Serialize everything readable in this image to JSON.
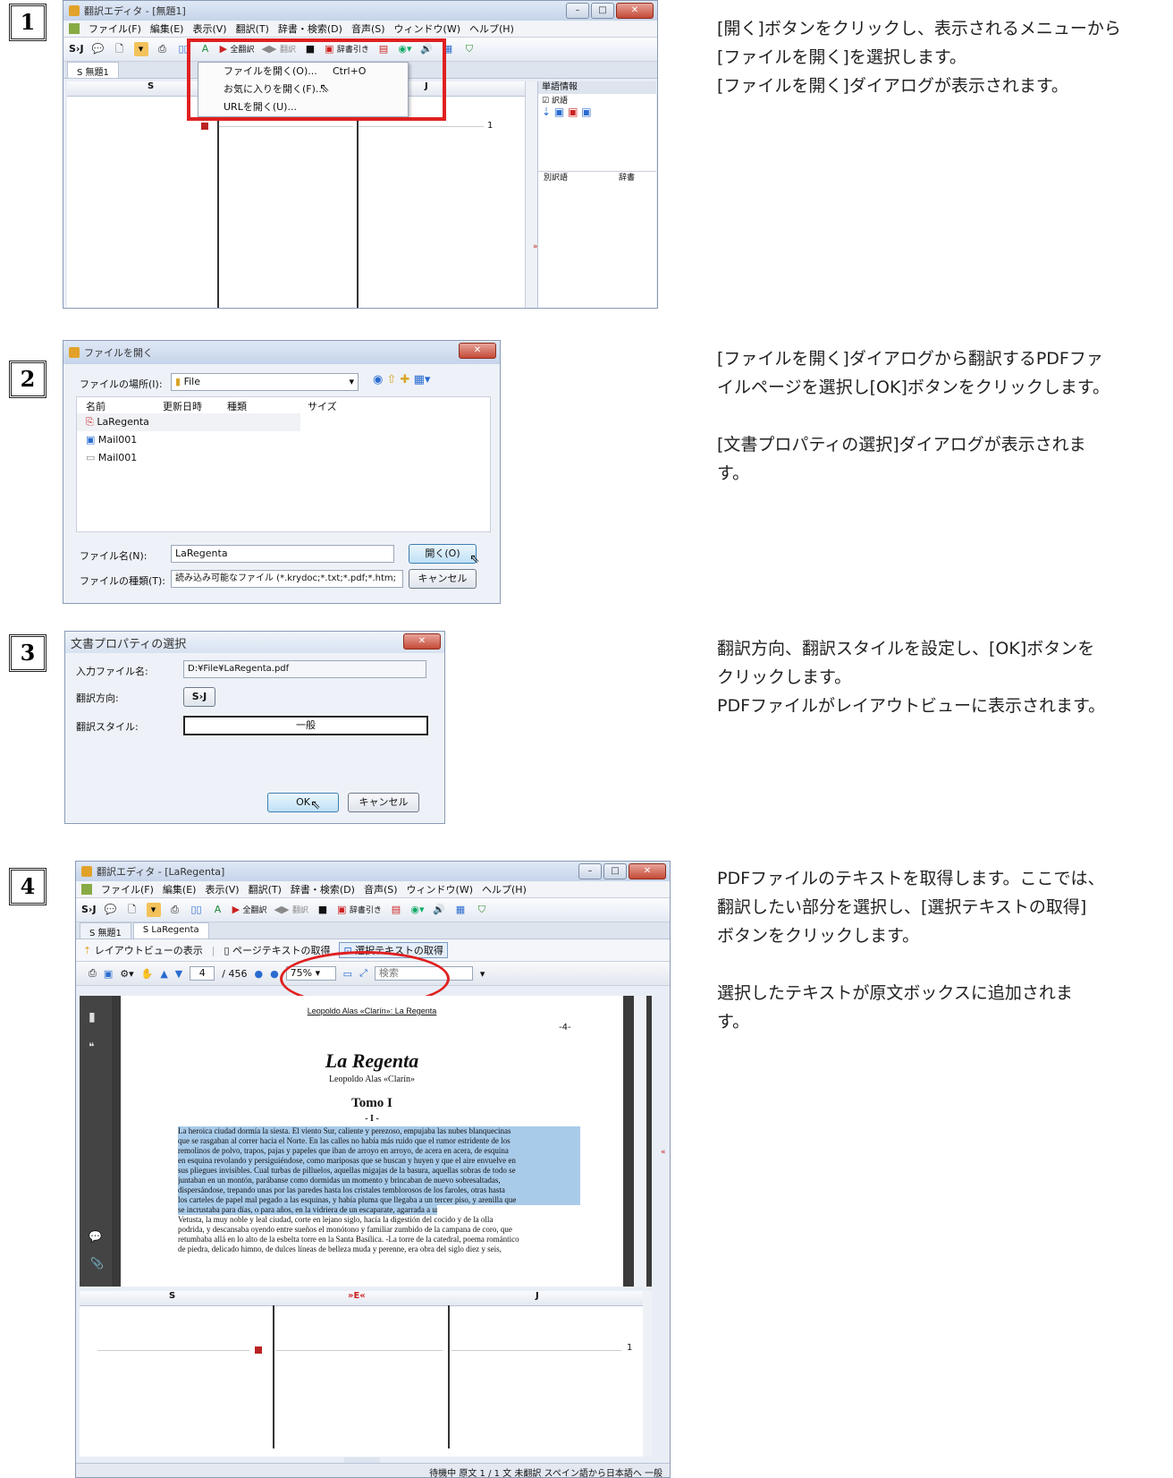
{
  "steps": [
    {
      "number": "1",
      "description": [
        "[開く]ボタンをクリックし、表示されるメニューから",
        "[ファイルを開く]を選択します。",
        "[ファイルを開く]ダイアログが表示されます。"
      ],
      "window_title": "翻訳エディタ - [無題1]",
      "menus": [
        "ファイル(F)",
        "編集(E)",
        "表示(V)",
        "翻訳(T)",
        "辞書・検索(D)",
        "音声(S)",
        "ウィンドウ(W)",
        "ヘルプ(H)"
      ],
      "toolbar": {
        "direction": "S›J",
        "all_translate": "全翻訳",
        "translate": "翻訳",
        "dict_lookup": "辞書引き"
      },
      "tab": "S 無題1",
      "columns": [
        "S",
        "J"
      ],
      "open_menu": [
        {
          "label": "ファイルを開く(O)...",
          "shortcut": "Ctrl+O"
        },
        {
          "label": "お気に入りを開く(F)...",
          "shortcut": ""
        },
        {
          "label": "URLを開く(U)...",
          "shortcut": ""
        }
      ],
      "side_panel": {
        "title": "単語情報",
        "checkbox": "訳語",
        "col_a": "別訳語",
        "col_b": "辞書"
      },
      "row_number": "1"
    },
    {
      "number": "2",
      "description": [
        "[ファイルを開く]ダイアログから翻訳するPDFファ",
        "イルページを選択し[OK]ボタンをクリックします。",
        "",
        "[文書プロパティの選択]ダイアログが表示されま",
        "す。"
      ],
      "dialog_title": "ファイルを開く",
      "location_label": "ファイルの場所(I):",
      "location_value": "File",
      "headers": [
        "名前",
        "更新日時",
        "種類",
        "サイズ"
      ],
      "files": [
        "LaRegenta",
        "Mail001",
        "Mail001"
      ],
      "filename_label": "ファイル名(N):",
      "filename_value": "LaRegenta",
      "filetype_label": "ファイルの種類(T):",
      "filetype_value": "読み込み可能なファイル (*.krydoc;*.txt;*.pdf;*.htm;",
      "open_button": "開く(O)",
      "cancel_button": "キャンセル"
    },
    {
      "number": "3",
      "description": [
        "翻訳方向、翻訳スタイルを設定し、[OK]ボタンを",
        "クリックします。",
        "PDFファイルがレイアウトビューに表示されます。"
      ],
      "dialog_title": "文書プロパティの選択",
      "input_file_label": "入力ファイル名:",
      "input_file_value": "D:¥File¥LaRegenta.pdf",
      "direction_label": "翻訳方向:",
      "direction_value": "S›J",
      "style_label": "翻訳スタイル:",
      "style_value": "一般",
      "ok_button": "OK",
      "cancel_button": "キャンセル"
    },
    {
      "number": "4",
      "description": [
        "PDFファイルのテキストを取得します。ここでは、",
        "翻訳したい部分を選択し、[選択テキストの取得]",
        "ボタンをクリックします。",
        "",
        "選択したテキストが原文ボックスに追加されま",
        "す。"
      ],
      "window_title": "翻訳エディタ - [LaRegenta]",
      "tabs": [
        "S 無題1",
        "S LaRegenta"
      ],
      "layout_buttons": [
        "レイアウトビューの表示",
        "ページテキストの取得",
        "選択テキストの取得"
      ],
      "page_current": "4",
      "page_total": "/ 456",
      "zoom": "75%",
      "search_placeholder": "検索",
      "pdf": {
        "header": "Leopoldo Alas «Clarín»: La Regenta",
        "page_no": "-4-",
        "title": "La Regenta",
        "author": "Leopoldo Alas «Clarín»",
        "tome": "Tomo I",
        "section": "- I -",
        "selected_lines": [
          "La heroica ciudad dormía la siesta. El viento Sur, caliente y perezoso, empujaba las nubes blanquecinas",
          "que se rasgaban al correr hacia el Norte. En las calles no había más ruido que el rumor estridente de los",
          "remolinos de polvo, trapos, pajas y papeles que iban de arroyo en arroyo, de acera en acera, de esquina",
          "en esquina revolando y persiguiéndose, como mariposas que se buscan y huyen y que el aire envuelve en",
          "sus pliegues invisibles. Cual turbas de pilluelos, aquellas migajas de la basura, aquellas sobras de todo se",
          "juntaban en un montón, parábanse como dormidas un momento y brincaban de nuevo sobresaltadas,",
          "dispersándose, trepando unas por las paredes hasta los cristales temblorosos de los faroles, otras hasta",
          "los carteles de papel mal pegado a las esquinas, y había pluma que llegaba a un tercer piso, y arenilla que",
          "se incrustaba para días, o para años, en la vidriera de un escaparate, agarrada a un plomo."
        ],
        "normal_lines": [
          "Vetusta, la muy noble y leal ciudad, corte en lejano siglo, hacía la digestión del cocido y de la olla",
          "podrida, y descansaba oyendo entre sueños el monótono y familiar zumbido de la campana de coro, que",
          "retumbaba allá en lo alto de la esbelta torre en la Santa Basílica. -La torre de la catedral, poema romántico",
          "de piedra, delicado himno, de dulces líneas de belleza muda y perenne, era obra del siglo diez y seis,"
        ]
      },
      "bottom_columns": [
        "S",
        "»E«",
        "J"
      ],
      "row_number": "1",
      "status": "待機中  原文  1 / 1 文  未翻訳  スペイン語から日本語へ  一般"
    }
  ],
  "colors": {
    "highlight_red": "#e02020",
    "selection_blue": "#a9cbea",
    "accent_blue": "#3c7fb1"
  }
}
